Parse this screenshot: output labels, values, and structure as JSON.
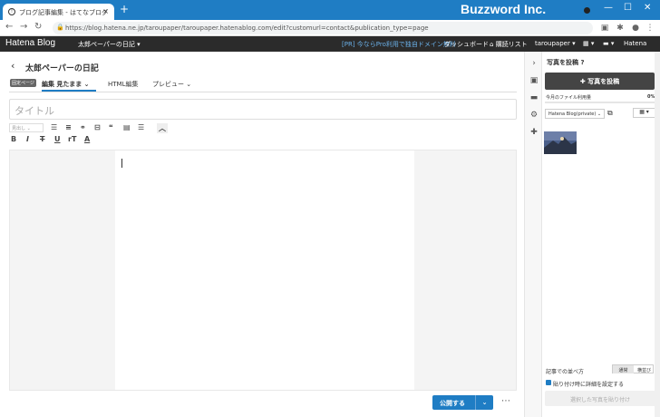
{
  "browser": {
    "tab_title": "ブログ記事編集 - はてなブログ",
    "tab_close": "×",
    "new_tab": "+",
    "brand_text": "Buzzword Inc.",
    "window_controls": [
      "—",
      "☐",
      "✕"
    ],
    "url": "https://blog.hatena.ne.jp/taroupaper/taroupaper.hatenablog.com/edit?customurl=contact&publication_type=page",
    "accent": "#1f7dc4"
  },
  "hatena_bar": {
    "logo": "Hatena Blog",
    "blog_name": "太郎ペーパーの日記 ▾",
    "promo": "[PR] 今ならPro利用で独自ドメイン無料",
    "dashboard": "ダッシュボード",
    "reading_list": "購読リスト",
    "user": "taroupaper ▾",
    "hatena": "Hatena"
  },
  "editor": {
    "page_title": "太郎ペーパーの日記",
    "badge": "固定ページ",
    "tabs": [
      "編集 見たまま ⌄",
      "HTML編集",
      "プレビュー ⌄"
    ],
    "title_placeholder": "タイトル",
    "format_select": "見出し ⌄",
    "publish_label": "公開する",
    "publish_caret": "⌄",
    "more": "⋯"
  },
  "toolbar_icons": [
    "unordered-list-icon",
    "ordered-list-icon",
    "link-icon",
    "page-break-icon",
    "quote-icon",
    "table-icon",
    "align-icon",
    "collapse-icon",
    "bold-icon",
    "italic-icon",
    "strike-icon",
    "underline-icon",
    "font-size-icon",
    "text-color-icon"
  ],
  "panel": {
    "header": "写真を投稿",
    "help": "?",
    "post_button": "✚ 写真を投稿",
    "usage_label": "今月のファイル利用量",
    "usage_pct": "0%",
    "usage_fraction": 0,
    "album": "Hatena Blog(private) ⌄",
    "grid": "▦ ▾",
    "sort_label": "記事での並べ方",
    "sort_options": [
      "通常",
      "横並び"
    ],
    "checkbox_label": "貼り付け時に詳細を設定する",
    "paste_button": "選択した写真を貼り付け"
  }
}
